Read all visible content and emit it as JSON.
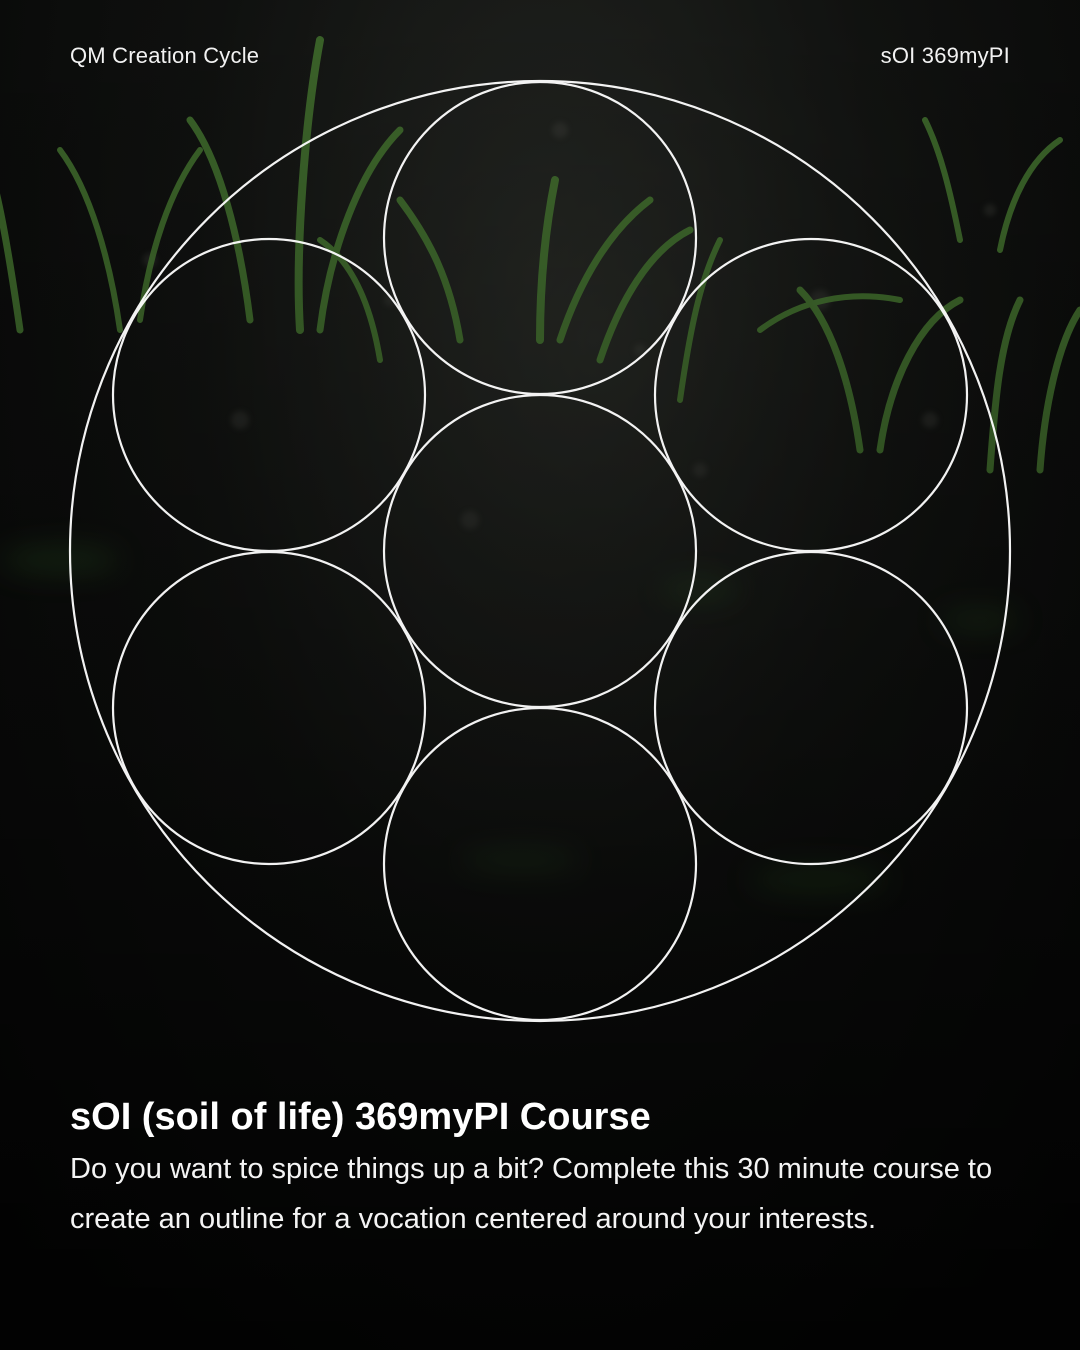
{
  "header": {
    "left_label": "QM Creation Cycle",
    "right_label": "sOI 369myPI"
  },
  "course": {
    "title": "sOI (soil of life) 369myPI Course",
    "description": "Do you want to spice things up a bit? Complete this 30 minute course to create an outline for a vocation centered around your interests."
  },
  "colors": {
    "background": "#0c0d0c",
    "sprout_green": "#4f8a3a",
    "line": "#ffffff",
    "text": "#ffffff"
  },
  "icons": {
    "diagram": "seven-circles-in-circle"
  }
}
